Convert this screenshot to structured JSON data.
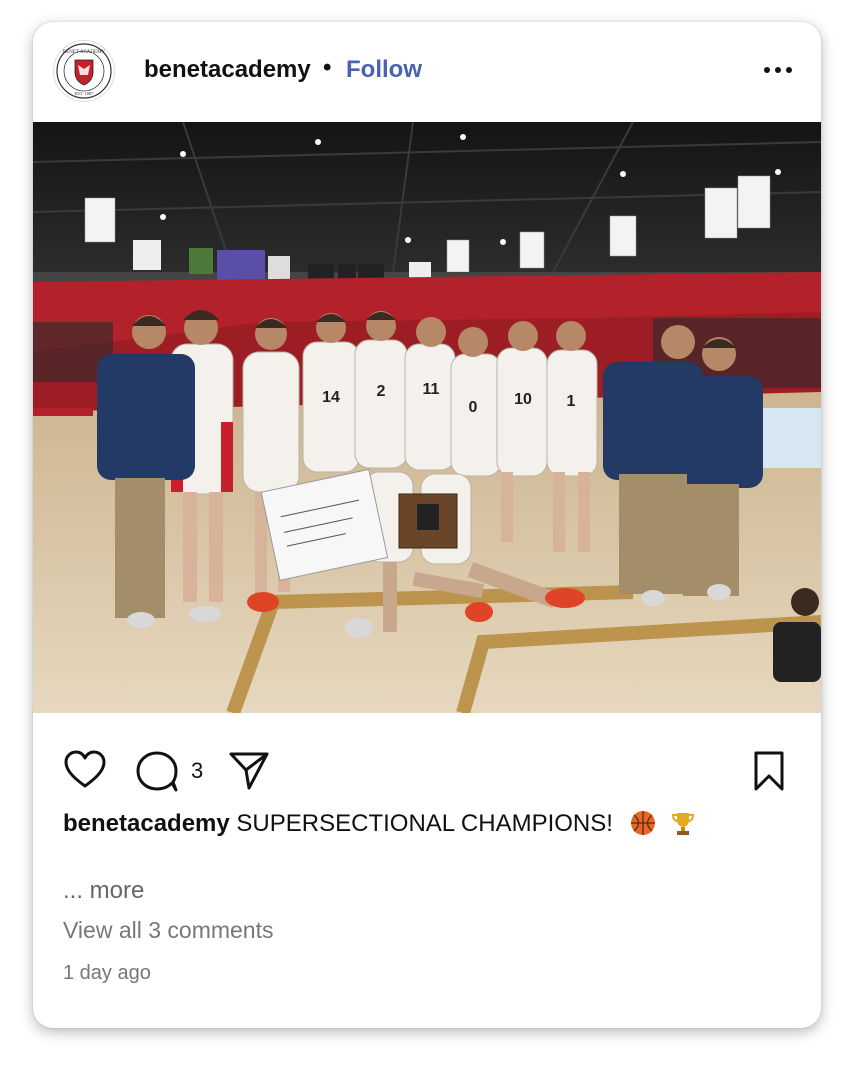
{
  "post": {
    "username": "benetacademy",
    "separator": "•",
    "follow_label": "Follow",
    "more_options_icon": "more-horizontal-icon",
    "avatar": {
      "seal_text_top": "BENET ACADEMY",
      "seal_text_bottom": "EST. 1887"
    },
    "image": {
      "description_icon": "team-photo"
    },
    "actions": {
      "like_icon": "heart-icon",
      "comment_icon": "comment-icon",
      "comment_count": "3",
      "share_icon": "send-icon",
      "save_icon": "bookmark-icon"
    },
    "caption": {
      "username": "benetacademy",
      "text": "SUPERSECTIONAL CHAMPIONS!",
      "emojis": [
        "basketball",
        "trophy"
      ]
    },
    "more_label": "... more",
    "view_comments_label": "View all 3 comments",
    "timestamp": "1 day ago"
  },
  "colors": {
    "follow": "#4a62b3",
    "court_red": "#c8202a"
  }
}
